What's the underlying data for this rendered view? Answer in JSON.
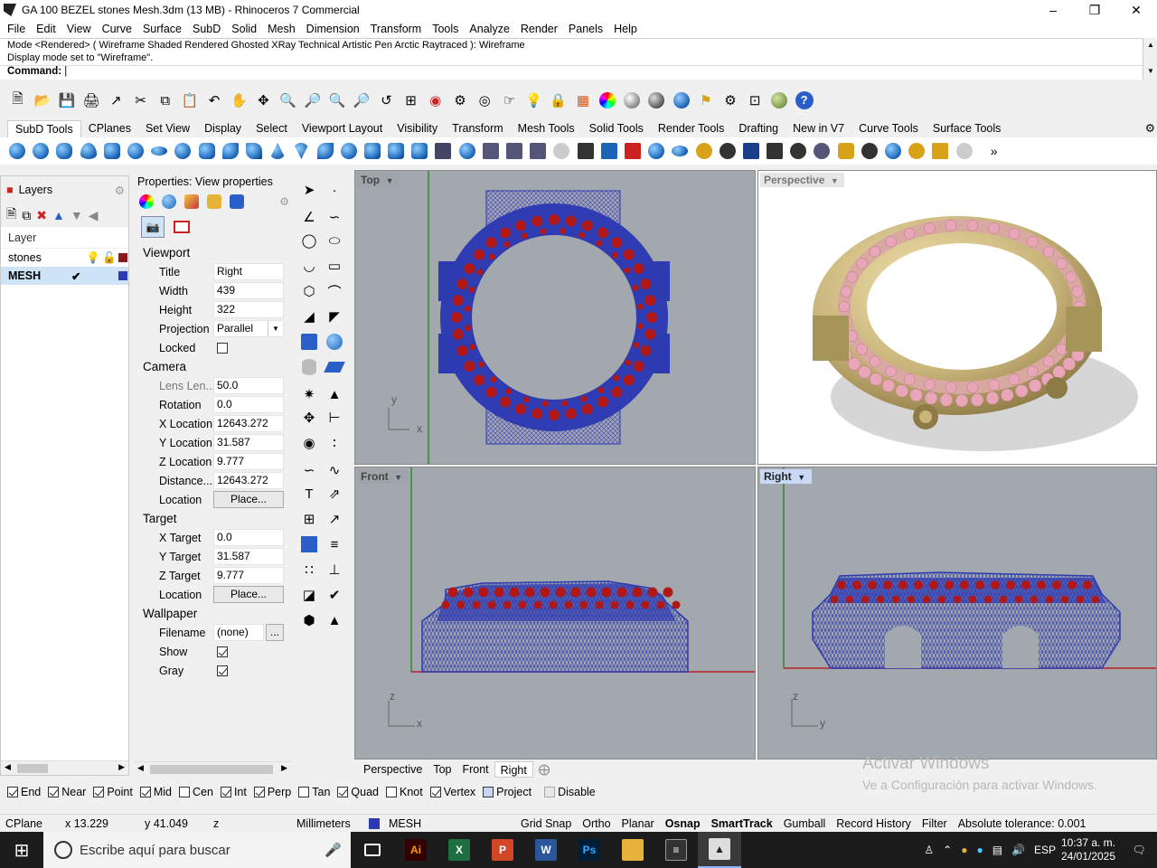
{
  "window": {
    "title": "GA 100 BEZEL stones Mesh.3dm (13 MB) - Rhinoceros 7 Commercial"
  },
  "menu": [
    "File",
    "Edit",
    "View",
    "Curve",
    "Surface",
    "SubD",
    "Solid",
    "Mesh",
    "Dimension",
    "Transform",
    "Tools",
    "Analyze",
    "Render",
    "Panels",
    "Help"
  ],
  "command": {
    "history_line1": "Mode <Rendered> ( Wireframe  Shaded  Rendered  Ghosted  XRay  Technical  Artistic  Pen  Arctic  Raytraced ): Wireframe",
    "history_line2": "Display mode set to \"Wireframe\".",
    "prompt": "Command:"
  },
  "toolbar_tabs": [
    "SubD Tools",
    "CPlanes",
    "Set View",
    "Display",
    "Select",
    "Viewport Layout",
    "Visibility",
    "Transform",
    "Mesh Tools",
    "Solid Tools",
    "Render Tools",
    "Drafting",
    "New in V7",
    "Curve Tools",
    "Surface Tools"
  ],
  "active_toolbar_tab": "SubD Tools",
  "layers": {
    "title": "Layers",
    "header": "Layer",
    "rows": [
      {
        "name": "stones",
        "color": "#8b1a1a"
      },
      {
        "name": "MESH",
        "color": "#2d3bb0",
        "current": true
      }
    ]
  },
  "properties": {
    "title": "Properties: View properties",
    "viewport_section": "Viewport",
    "title_label": "Title",
    "title_value": "Right",
    "width_label": "Width",
    "width_value": "439",
    "height_label": "Height",
    "height_value": "322",
    "projection_label": "Projection",
    "projection_value": "Parallel",
    "locked_label": "Locked",
    "camera_section": "Camera",
    "lens_label": "Lens Len...",
    "lens_value": "50.0",
    "rotation_label": "Rotation",
    "rotation_value": "0.0",
    "xloc_label": "X Location",
    "xloc_value": "12643.272",
    "yloc_label": "Y Location",
    "yloc_value": "31.587",
    "zloc_label": "Z Location",
    "zloc_value": "9.777",
    "dist_label": "Distance...",
    "dist_value": "12643.272",
    "location_label": "Location",
    "place_button": "Place...",
    "target_section": "Target",
    "xtarget_label": "X Target",
    "xtarget_value": "0.0",
    "ytarget_label": "Y Target",
    "ytarget_value": "31.587",
    "ztarget_label": "Z Target",
    "ztarget_value": "9.777",
    "tlocation_label": "Location",
    "tplace_button": "Place...",
    "wallpaper_section": "Wallpaper",
    "filename_label": "Filename",
    "filename_value": "(none)",
    "filename_button": "...",
    "show_label": "Show",
    "gray_label": "Gray"
  },
  "viewports": {
    "top": "Top",
    "perspective": "Perspective",
    "front": "Front",
    "right": "Right",
    "axis_x": "x",
    "axis_y": "y",
    "axis_z": "z"
  },
  "viewport_tabs": [
    "Perspective",
    "Top",
    "Front",
    "Right"
  ],
  "active_viewport_tab": "Right",
  "osnap": {
    "items": [
      {
        "label": "End",
        "checked": true
      },
      {
        "label": "Near",
        "checked": true
      },
      {
        "label": "Point",
        "checked": true
      },
      {
        "label": "Mid",
        "checked": true
      },
      {
        "label": "Cen",
        "checked": false
      },
      {
        "label": "Int",
        "checked": true
      },
      {
        "label": "Perp",
        "checked": true
      },
      {
        "label": "Tan",
        "checked": false
      },
      {
        "label": "Quad",
        "checked": true
      },
      {
        "label": "Knot",
        "checked": false
      },
      {
        "label": "Vertex",
        "checked": true
      }
    ],
    "project": "Project",
    "disable": "Disable"
  },
  "watermark": {
    "line1": "Activar Windows",
    "line2": "Ve a Configuración para activar Windows."
  },
  "status": {
    "cplane": "CPlane",
    "x": "x 13.229",
    "y": "y 41.049",
    "z": "z",
    "units": "Millimeters",
    "layer": "MESH",
    "grid_snap": "Grid Snap",
    "ortho": "Ortho",
    "planar": "Planar",
    "osnap": "Osnap",
    "smarttrack": "SmartTrack",
    "gumball": "Gumball",
    "record_history": "Record History",
    "filter": "Filter",
    "tolerance": "Absolute tolerance: 0.001"
  },
  "taskbar": {
    "search_placeholder": "Escribe aquí para buscar",
    "lang": "ESP",
    "time": "10:37 a. m.",
    "date": "24/01/2025"
  },
  "colors": {
    "mesh": "#2d3bb0",
    "stones": "#8b1a1a",
    "viewport_bg": "#a3a7ae"
  }
}
